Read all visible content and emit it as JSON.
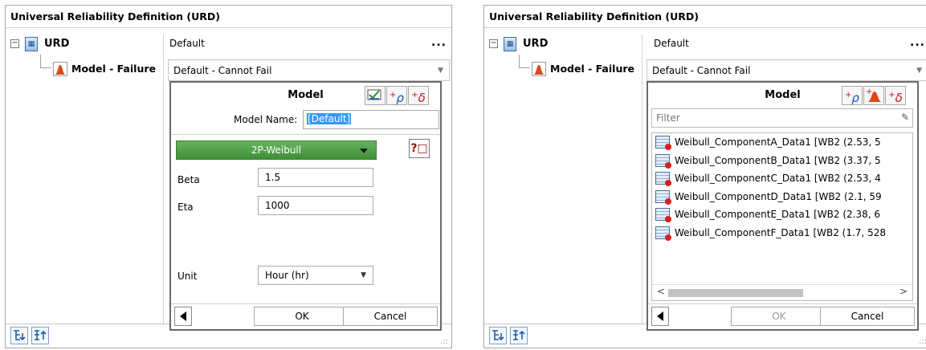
{
  "panel_title": "Universal Reliability Definition (URD)",
  "tree": {
    "root_label": "URD",
    "child_label": "Model - Failure"
  },
  "cells": {
    "root_value": "Default",
    "ellipsis": "...",
    "model_value": "Default - Cannot Fail"
  },
  "left_popup": {
    "title": "Model",
    "model_name_label": "Model Name:",
    "model_name_value": "[Default]",
    "distribution": "2P-Weibull",
    "help_label": "?□",
    "params": [
      {
        "label": "Beta",
        "value": "1.5"
      },
      {
        "label": "Eta",
        "value": "1000"
      }
    ],
    "unit_label": "Unit",
    "unit_value": "Hour (hr)",
    "ok_label": "OK",
    "cancel_label": "Cancel"
  },
  "right_popup": {
    "title": "Model",
    "filter_placeholder": "Filter",
    "items": [
      "Weibull_ComponentA_Data1 [WB2 (2.53, 5",
      "Weibull_ComponentB_Data1 [WB2 (3.37, 5",
      "Weibull_ComponentC_Data1 [WB2 (2.53, 4",
      "Weibull_ComponentD_Data1 [WB2 (2.1, 59",
      "Weibull_ComponentE_Data1 [WB2 (2.38, 6",
      "Weibull_ComponentF_Data1 [WB2 (1.7, 528"
    ],
    "ok_label": "OK",
    "cancel_label": "Cancel"
  },
  "icons": {
    "rho": "ρ",
    "delta": "δ",
    "plus": "+"
  },
  "colors": {
    "distribution_green": "#4fa046",
    "selection_blue": "#3399ff",
    "delta_red": "#c01818",
    "rho_blue": "#1d58b8"
  }
}
